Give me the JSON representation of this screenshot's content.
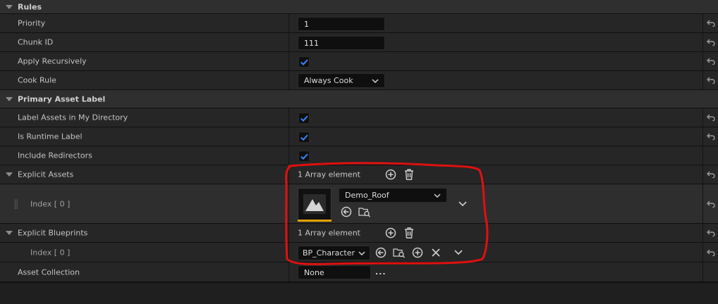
{
  "rows": {
    "rules": {
      "label": "Rules"
    },
    "priority": {
      "label": "Priority",
      "value": "1"
    },
    "chunk_id": {
      "label": "Chunk ID",
      "value": "111"
    },
    "apply_recursively": {
      "label": "Apply Recursively",
      "checked": true
    },
    "cook_rule": {
      "label": "Cook Rule",
      "value": "Always Cook"
    },
    "primary_asset_label": {
      "label": "Primary Asset Label"
    },
    "label_assets": {
      "label": "Label Assets in My Directory",
      "checked": true
    },
    "is_runtime_label": {
      "label": "Is Runtime Label",
      "checked": true
    },
    "include_redirectors": {
      "label": "Include Redirectors",
      "checked": true
    },
    "explicit_assets": {
      "label": "Explicit Assets",
      "summary": "1 Array element"
    },
    "explicit_assets_index0": {
      "label": "Index [ 0 ]",
      "asset": "Demo_Roof"
    },
    "explicit_blueprints": {
      "label": "Explicit Blueprints",
      "summary": "1 Array element"
    },
    "explicit_blueprints_index0": {
      "label": "Index [ 0 ]",
      "value": "BP_Character"
    },
    "asset_collection": {
      "label": "Asset Collection",
      "value": "None",
      "more": "..."
    }
  },
  "colors": {
    "accent_check": "#3a86ff",
    "thumb_underline": "#e5a200",
    "annotation": "#e01010"
  }
}
